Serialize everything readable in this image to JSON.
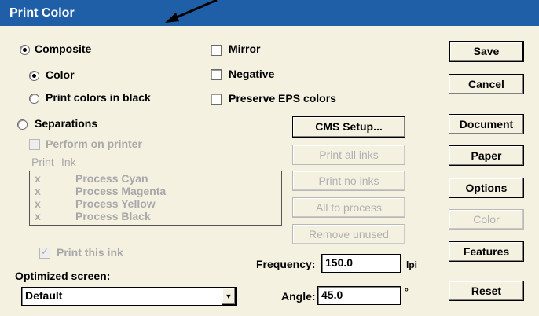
{
  "window": {
    "title": "Print Color"
  },
  "left": {
    "composite": "Composite",
    "color": "Color",
    "print_colors_in_black": "Print colors in black",
    "separations": "Separations",
    "perform_on_printer": "Perform on printer",
    "list_header": {
      "print": "Print",
      "ink": "Ink"
    },
    "inks": [
      {
        "mark": "x",
        "name": "Process Cyan"
      },
      {
        "mark": "x",
        "name": "Process Magenta"
      },
      {
        "mark": "x",
        "name": "Process Yellow"
      },
      {
        "mark": "x",
        "name": "Process Black"
      }
    ],
    "print_this_ink": "Print this ink",
    "optimized_screen_label": "Optimized screen:",
    "optimized_screen_value": "Default"
  },
  "middle": {
    "mirror": "Mirror",
    "negative": "Negative",
    "preserve_eps": "Preserve EPS colors",
    "cms_setup": "CMS Setup...",
    "print_all_inks": "Print all inks",
    "print_no_inks": "Print no inks",
    "all_to_process": "All to process",
    "remove_unused": "Remove unused",
    "frequency_label": "Frequency:",
    "frequency_value": "150.0",
    "frequency_unit": "lpi",
    "angle_label": "Angle:",
    "angle_value": "45.0",
    "angle_unit": "°"
  },
  "right": {
    "save": "Save",
    "cancel": "Cancel",
    "document": "Document",
    "paper": "Paper",
    "options": "Options",
    "color": "Color",
    "features": "Features",
    "reset": "Reset"
  },
  "state": {
    "composite_selected": true,
    "color_selected": true,
    "separations_selected": false,
    "mirror_checked": false,
    "negative_checked": false,
    "preserve_eps_checked": false,
    "perform_on_printer_checked": false,
    "print_this_ink_checked": true
  }
}
